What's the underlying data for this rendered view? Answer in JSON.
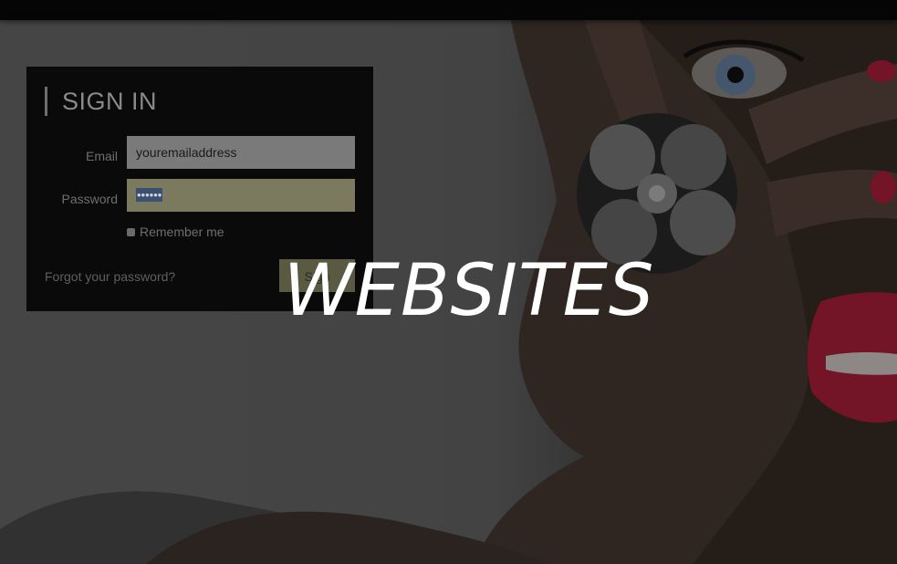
{
  "overlay": {
    "title": "WEBSITES"
  },
  "signin": {
    "title": "SIGN IN",
    "email_label": "Email",
    "email_value": "youremailaddress",
    "password_label": "Password",
    "password_value": "••••••",
    "remember_label": "Remember me",
    "forgot_link": "Forgot your password?",
    "submit_label": "Sign"
  },
  "colors": {
    "panel": "#0a0a0a",
    "password_autofill": "#7b7a5e",
    "lips": "#b3203c"
  },
  "icons": {
    "remember": "checkbox"
  }
}
